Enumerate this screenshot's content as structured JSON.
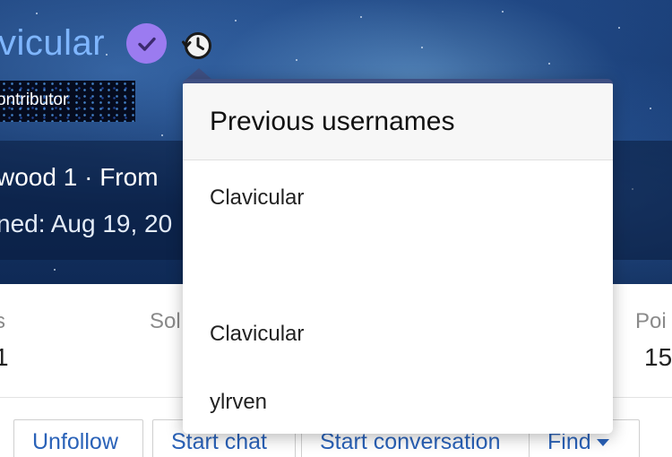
{
  "profile": {
    "username": "vicular",
    "role": "ontributor",
    "info_line_1_a": "wood 1",
    "info_line_1_sep": " · ",
    "info_line_1_b": "From",
    "info_line_2": "ned: Aug 19, 20"
  },
  "stats": [
    {
      "label": "s",
      "value": "1"
    },
    {
      "label": "Sol",
      "value": ""
    },
    {
      "label": "Poi",
      "value": "15"
    }
  ],
  "actions": {
    "unfollow": "Unfollow",
    "start_chat": "Start chat",
    "start_conversation": "Start conversation",
    "find": "Find"
  },
  "popover": {
    "title": "Previous usernames",
    "names": [
      "Clavicular",
      "",
      "Clavicular",
      "ylrven"
    ]
  },
  "colors": {
    "username": "#7fb6ff",
    "verified": "#9b7bf0",
    "link": "#2a62b8",
    "popover_accent": "#3e4f82"
  },
  "icons": {
    "verified": "check-circle-icon",
    "history": "history-icon",
    "find_caret": "caret-down-icon"
  }
}
